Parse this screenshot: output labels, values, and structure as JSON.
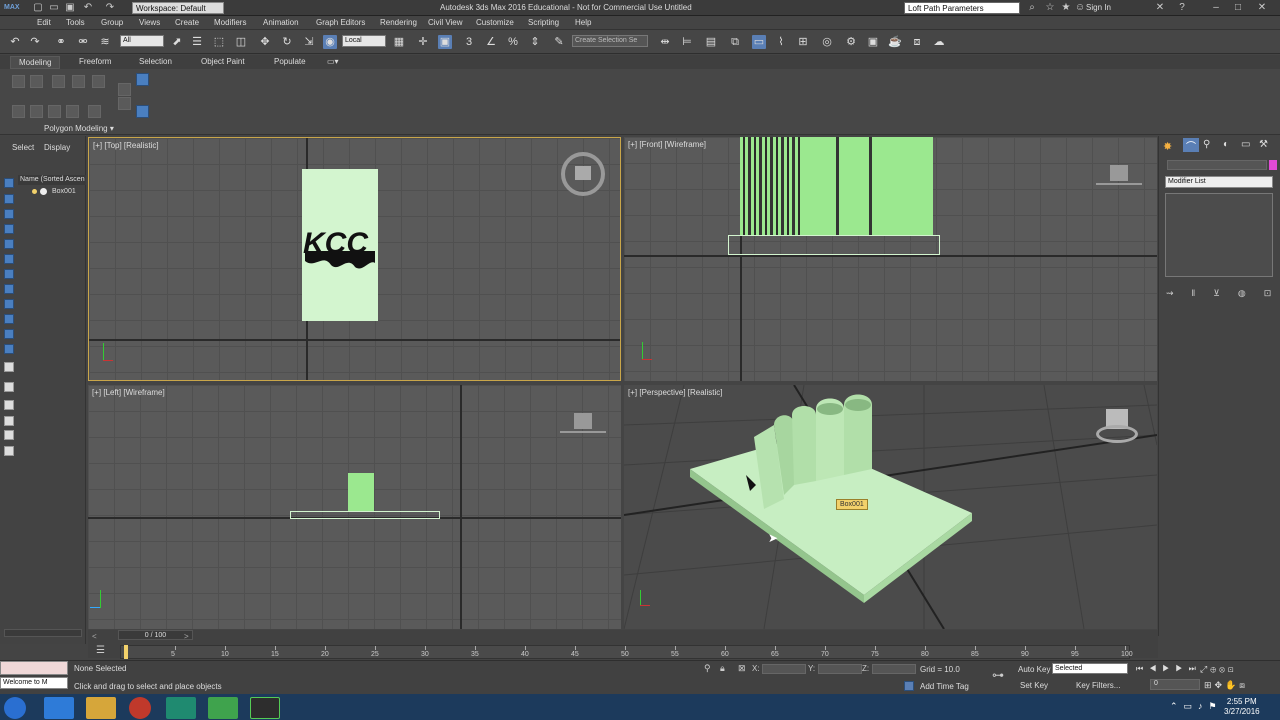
{
  "window": {
    "title": "Autodesk 3ds Max 2016 Educational - Not for Commercial Use   Untitled",
    "workspace": "Workspace: Default",
    "search_value": "Loft Path Parameters",
    "sign_in": "Sign In",
    "app_badge": "MAX"
  },
  "menu": [
    "Edit",
    "Tools",
    "Group",
    "Views",
    "Create",
    "Modifiers",
    "Animation",
    "Graph Editors",
    "Rendering",
    "Civil View",
    "Customize",
    "Scripting",
    "Help"
  ],
  "toolbar": {
    "filter": "All",
    "ref_coord": "Local",
    "named_selection": "Create Selection Se"
  },
  "ribbon": {
    "tabs": [
      "Modeling",
      "Freeform",
      "Selection",
      "Object Paint",
      "Populate"
    ],
    "active_tab": "Modeling",
    "panel_label": "Polygon Modeling ▾"
  },
  "scene_explorer": {
    "tabs": [
      "Select",
      "Display"
    ],
    "column": "Name (Sorted Ascen",
    "item": "Box001"
  },
  "viewports": {
    "top": "[+] [Top] [Realistic]",
    "front": "[+] [Front] [Wireframe]",
    "left": "[+] [Left] [Wireframe]",
    "perspective": "[+] [Perspective] [Realistic]",
    "object_tag": "Box001",
    "top_logo_text": "KCC"
  },
  "command_panel": {
    "modifier_list": "Modifier List"
  },
  "timeline": {
    "slider": "0 / 100",
    "ticks": [
      "0",
      "5",
      "10",
      "15",
      "20",
      "25",
      "30",
      "35",
      "40",
      "45",
      "50",
      "55",
      "60",
      "65",
      "70",
      "75",
      "80",
      "85",
      "90",
      "95",
      "100"
    ]
  },
  "status": {
    "welcome": "Welcome to M",
    "selection": "None Selected",
    "prompt": "Click and drag to select and place objects",
    "x_label": "X:",
    "y_label": "Y:",
    "z_label": "Z:",
    "grid": "Grid = 10.0",
    "add_time_tag": "Add Time Tag",
    "auto_key": "Auto Key",
    "auto_key_mode": "Selected",
    "set_key": "Set Key",
    "key_filters": "Key Filters...",
    "frame": "0"
  },
  "clock": {
    "time": "2:55 PM",
    "date": "3/27/2016"
  },
  "colors": {
    "object_green": "#b8eeb0",
    "wire_green": "#9be88f",
    "highlight_yellow": "#c9a64a",
    "taskbar": "#1c3a5c"
  }
}
